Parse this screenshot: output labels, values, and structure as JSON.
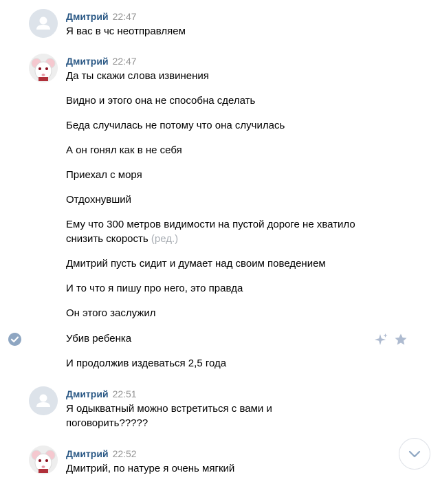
{
  "messages": [
    {
      "author": "Дмитрий",
      "time": "22:47",
      "lines": [
        "Я вас в чс неотправляем"
      ]
    },
    {
      "author": "Дмитрий",
      "time": "22:47",
      "lines": [
        "Да ты скажи слова извинения",
        "Видно и этого она не способна сделать",
        "Беда случилась не потому что она случилась",
        "А он гонял как в не себя",
        "Приехал с моря",
        "Отдохнувший",
        "Ему что 300 метров видимости на пустой дороге не хватило",
        "снизить скорость",
        "(ред.)",
        "Дмитрий пусть сидит и думает над своим поведением",
        "И то что я пишу про него, это правда",
        "Он этого заслужил",
        "Убив ребенка",
        "И продолжив издеваться 2,5 года"
      ]
    },
    {
      "author": "Дмитрий",
      "time": "22:51",
      "lines": [
        "Я одыкватный можно встретиться с вами и",
        "поговорить?????"
      ]
    },
    {
      "author": "Дмитрий",
      "time": "22:52",
      "lines": [
        "Дмитрий, по натуре я очень мягкий"
      ]
    }
  ],
  "icons": {
    "selected_check": "check-circle-icon",
    "reply_action": "sparkle-icon",
    "favorite_action": "star-icon",
    "scroll_down": "chevron-down-icon"
  },
  "colors": {
    "author": "#2a5885",
    "time": "#939393",
    "edited": "#a8adb3",
    "check": "#8ea6c2",
    "action_icons": "#aebbd0"
  }
}
